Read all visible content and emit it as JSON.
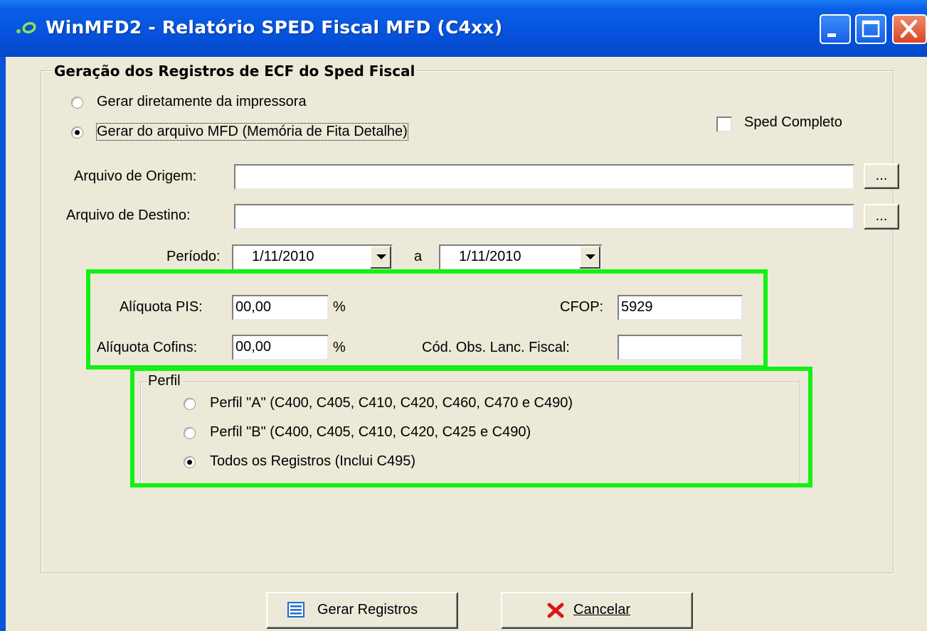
{
  "window": {
    "title": "WinMFD2 - Relatório SPED Fiscal MFD (C4xx)",
    "controls": {
      "minimize": "minimize-icon",
      "maximize": "maximize-icon",
      "close": "close-icon"
    }
  },
  "group": {
    "title": "Geração dos Registros de ECF do Sped Fiscal",
    "radio_printer": {
      "label": "Gerar diretamente da impressora",
      "checked": false
    },
    "radio_mfd": {
      "label": "Gerar do arquivo MFD (Memória de Fita Detalhe)",
      "checked": true
    },
    "sped_completo": {
      "label": "Sped Completo",
      "checked": false
    },
    "origem": {
      "label": "Arquivo de Origem:",
      "value": "",
      "browse": "..."
    },
    "destino": {
      "label": "Arquivo de Destino:",
      "value": "",
      "browse": "..."
    },
    "periodo": {
      "label": "Período:",
      "start": "1/11/2010",
      "sep": "a",
      "end": "1/11/2010"
    },
    "pis": {
      "label": "Alíquota PIS:",
      "value": "00,00",
      "unit": "%"
    },
    "cofins": {
      "label": "Alíquota Cofins:",
      "value": "00,00",
      "unit": "%"
    },
    "cfop": {
      "label": "CFOP:",
      "value": "5929"
    },
    "cod_obs": {
      "label": "Cód. Obs. Lanc. Fiscal:",
      "value": ""
    }
  },
  "perfil": {
    "title": "Perfil",
    "options": [
      {
        "label": "Perfil \"A\" (C400, C405, C410, C420, C460, C470 e C490)",
        "checked": false
      },
      {
        "label": "Perfil \"B\" (C400, C405, C410, C420, C425 e C490)",
        "checked": false
      },
      {
        "label": "Todos os Registros (Inclui C495)",
        "checked": true
      }
    ]
  },
  "buttons": {
    "gerar": {
      "label": "Gerar Registros",
      "icon": "list-icon"
    },
    "cancelar": {
      "label": "Cancelar",
      "icon": "red-x-icon"
    }
  },
  "colors": {
    "highlight": "#14f014",
    "titlebar": "#0652dd",
    "client": "#ece9d8"
  }
}
